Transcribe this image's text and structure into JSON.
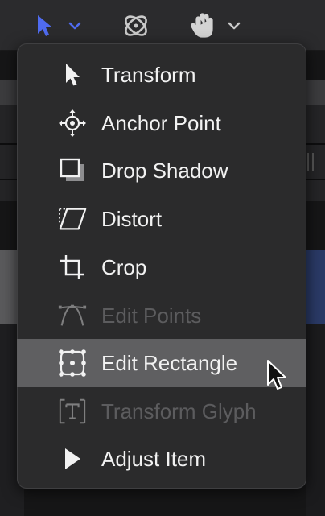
{
  "toolbar": {
    "tools": [
      {
        "icon": "arrow-pointer-icon",
        "active": true,
        "has_menu": true
      },
      {
        "icon": "3d-orbit-icon",
        "active": false,
        "has_menu": false
      },
      {
        "icon": "pan-hand-icon",
        "active": false,
        "has_menu": true
      }
    ],
    "accent_color": "#4f6bf0"
  },
  "menu": {
    "items": [
      {
        "label": "Transform",
        "icon": "arrow-icon",
        "enabled": true
      },
      {
        "label": "Anchor Point",
        "icon": "anchor-point-icon",
        "enabled": true
      },
      {
        "label": "Drop Shadow",
        "icon": "drop-shadow-icon",
        "enabled": true
      },
      {
        "label": "Distort",
        "icon": "distort-icon",
        "enabled": true
      },
      {
        "label": "Crop",
        "icon": "crop-icon",
        "enabled": true
      },
      {
        "label": "Edit Points",
        "icon": "edit-points-icon",
        "enabled": false
      },
      {
        "label": "Edit Rectangle",
        "icon": "edit-rectangle-icon",
        "enabled": true,
        "highlighted": true
      },
      {
        "label": "Transform Glyph",
        "icon": "transform-glyph-icon",
        "enabled": false
      },
      {
        "label": "Adjust Item",
        "icon": "adjust-item-icon",
        "enabled": true
      }
    ]
  },
  "colors": {
    "menu_bg": "#2b2b2c",
    "highlight": "#5f5f61",
    "text": "#f2f2f2",
    "disabled_text": "#5c5c5e"
  }
}
